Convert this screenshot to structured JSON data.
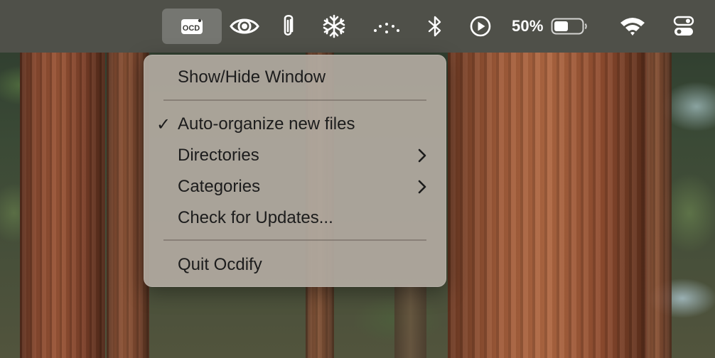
{
  "status_bar": {
    "ocdify_icon_text": "OCD",
    "battery_percent": "50%",
    "battery_level": 0.5,
    "icons": [
      "ocdify-icon",
      "eye-icon",
      "paperclip-icon",
      "snowflake-icon",
      "dots-icon",
      "bluetooth-icon",
      "play-icon",
      "battery-icon",
      "wifi-icon",
      "control-center-icon"
    ]
  },
  "menu": {
    "items": [
      {
        "label": "Show/Hide Window"
      },
      {
        "label": "Auto-organize new files",
        "checked": true,
        "check_glyph": "✓"
      },
      {
        "label": "Directories",
        "submenu": true
      },
      {
        "label": "Categories",
        "submenu": true
      },
      {
        "label": "Check for Updates..."
      },
      {
        "label": "Quit Ocdify"
      }
    ]
  }
}
